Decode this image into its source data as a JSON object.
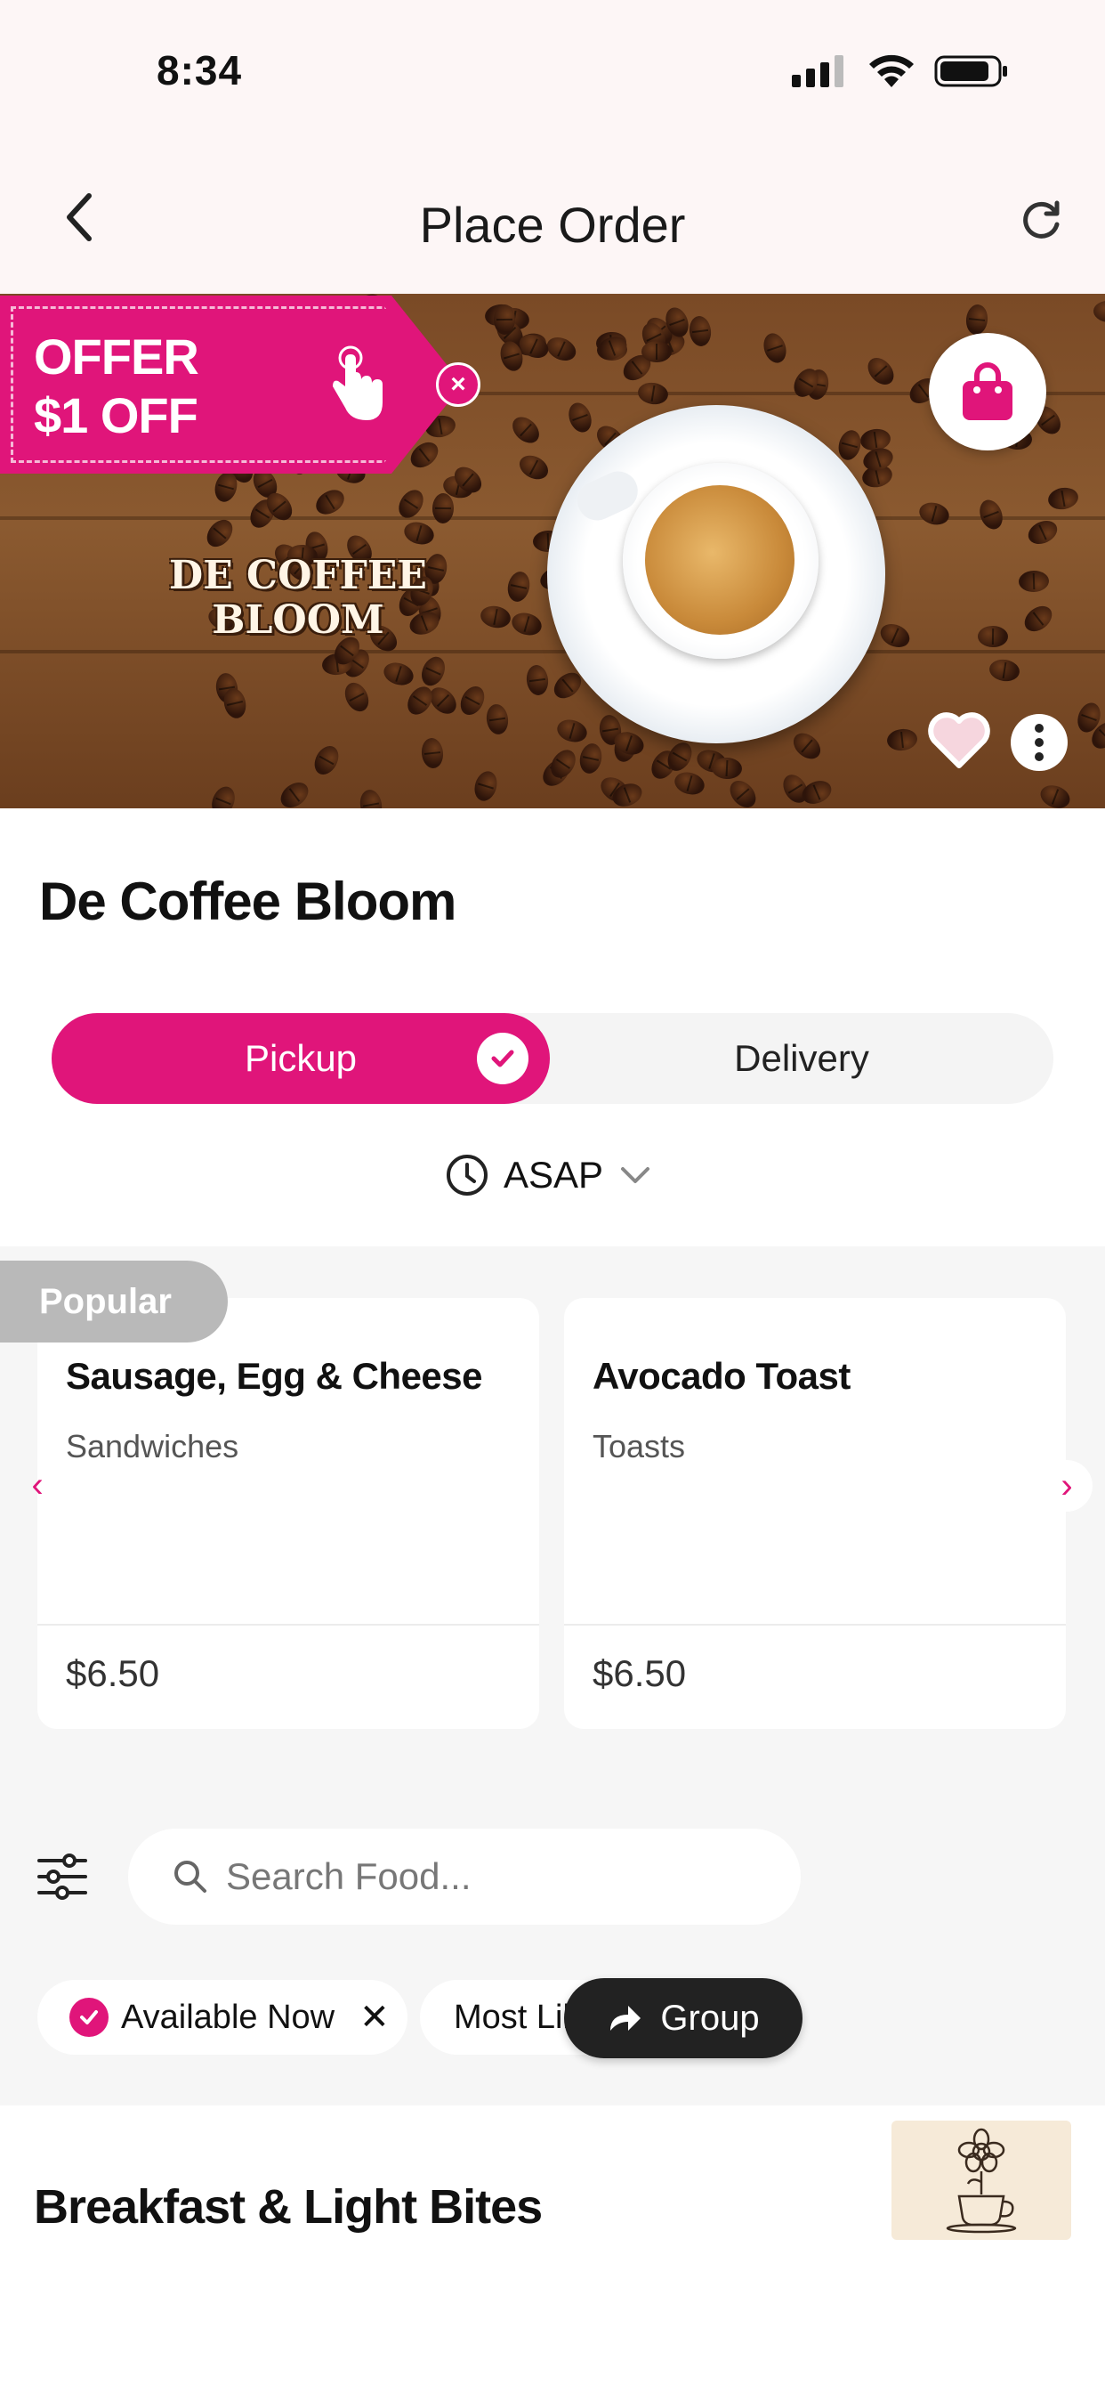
{
  "status_bar": {
    "time": "8:34"
  },
  "nav": {
    "title": "Place Order"
  },
  "hero": {
    "offer_line1": "OFFER",
    "offer_line2": "$1 OFF",
    "offer_close": "×",
    "brand_logo_text": "DE COFFEE BLOOM"
  },
  "store": {
    "name": "De Coffee Bloom"
  },
  "order_mode": {
    "pickup_label": "Pickup",
    "delivery_label": "Delivery",
    "selected": "Pickup"
  },
  "time_select": {
    "value": "ASAP"
  },
  "popular": {
    "tag": "Popular",
    "items": [
      {
        "name": "Sausage, Egg & Cheese",
        "category": "Sandwiches",
        "price": "$6.50"
      },
      {
        "name": "Avocado Toast",
        "category": "Toasts",
        "price": "$6.50"
      }
    ],
    "prev": "‹",
    "next": "›"
  },
  "search": {
    "placeholder": "Search Food..."
  },
  "filters": {
    "available_now": "Available Now",
    "remove": "✕",
    "most_liked": "Most Liked"
  },
  "group_button": {
    "label": "Group"
  },
  "section": {
    "title": "Breakfast & Light Bites"
  },
  "colors": {
    "accent": "#e0157a",
    "dark": "#222222",
    "section_bg": "#f6f6f6"
  }
}
